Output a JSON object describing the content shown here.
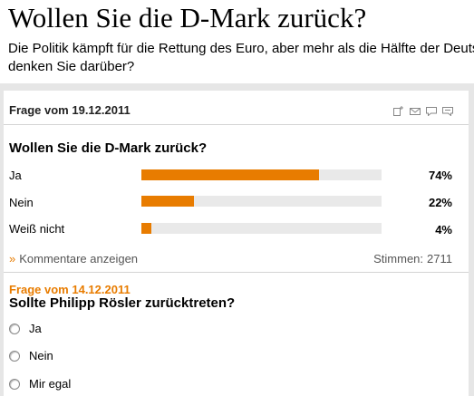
{
  "headline": "Wollen Sie die D-Mark zurück?",
  "intro": {
    "line1": "Die Politik kämpft für die Rettung des Euro, aber mehr als die Hälfte der Deuts",
    "line2": "denken Sie darüber?"
  },
  "poll": {
    "date_label": "Frage vom 19.12.2011",
    "question": "Wollen Sie die D-Mark zurück?",
    "options": [
      {
        "label": "Ja",
        "percent": 74,
        "percent_text": "74%"
      },
      {
        "label": "Nein",
        "percent": 22,
        "percent_text": "22%"
      },
      {
        "label": "Weiß nicht",
        "percent": 4,
        "percent_text": "4%"
      }
    ],
    "comments_arrow": "»",
    "comments_label": "Kommentare anzeigen",
    "votes_label": "Stimmen:",
    "votes_count": "2711",
    "share_icons": [
      "bookmark-add-icon",
      "mail-icon",
      "comment-icon",
      "speech-bubble-icon"
    ]
  },
  "next_poll": {
    "date_label": "Frage vom 14.12.2011",
    "question": "Sollte Philipp Rösler zurücktreten?",
    "options": [
      "Ja",
      "Nein",
      "Mir egal"
    ]
  },
  "colors": {
    "accent": "#e87c00",
    "track": "#e9e9e9",
    "frame": "#e6e6e6"
  }
}
